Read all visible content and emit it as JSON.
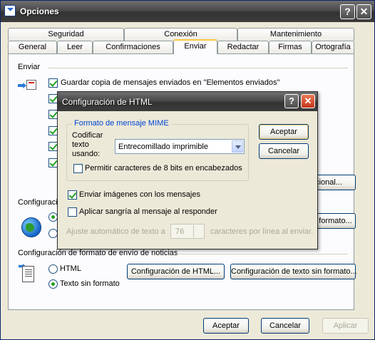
{
  "window": {
    "title": "Opciones",
    "help_glyph": "?",
    "close_glyph": "✕"
  },
  "tabs_row1": [
    "Seguridad",
    "Conexión",
    "Mantenimiento"
  ],
  "tabs_row2": [
    "General",
    "Leer",
    "Confirmaciones",
    "Enviar",
    "Redactar",
    "Firmas",
    "Ortografía"
  ],
  "active_tab": "Enviar",
  "send_section": {
    "heading": "Enviar",
    "save_copy_label": "Guardar copia de mensajes enviados en \"Elementos enviados\"",
    "international_button": "acional..."
  },
  "mail_format": {
    "heading": "Configuraci",
    "format_button": "formato..."
  },
  "news_format": {
    "heading": "Configuración de formato de envío de noticias",
    "html_label": "HTML",
    "plain_label": "Texto sin formato",
    "html_settings_button": "Configuración de HTML...",
    "plain_settings_button": "Configuración de texto sin formato..."
  },
  "footer": {
    "ok": "Aceptar",
    "cancel": "Cancelar",
    "apply": "Aplicar"
  },
  "html_dialog": {
    "title": "Configuración de HTML",
    "help_glyph": "?",
    "close_glyph": "✕",
    "mime_legend": "Formato de mensaje MIME",
    "encode_label_1": "Codificar",
    "encode_label_2": "texto",
    "encode_label_3": "usando:",
    "encoding_value": "Entrecomillado imprimible",
    "allow_8bit_label": "Permitir caracteres de 8 bits en encabezados",
    "send_images_label": "Enviar imágenes con los mensajes",
    "indent_label": "Aplicar sangría al mensaje al responder",
    "wrap_prefix": "Ajuste automático de texto a",
    "wrap_value": "76",
    "wrap_suffix": "caracteres por línea al enviar.",
    "ok": "Aceptar",
    "cancel": "Cancelar",
    "allow_8bit_checked": false,
    "send_images_checked": true,
    "indent_checked": false
  },
  "icons": [
    "app-icon",
    "help-icon",
    "close-icon",
    "mail-send-icon",
    "globe-icon",
    "news-doc-icon",
    "dropdown-arrow-icon",
    "spinner-icon"
  ]
}
